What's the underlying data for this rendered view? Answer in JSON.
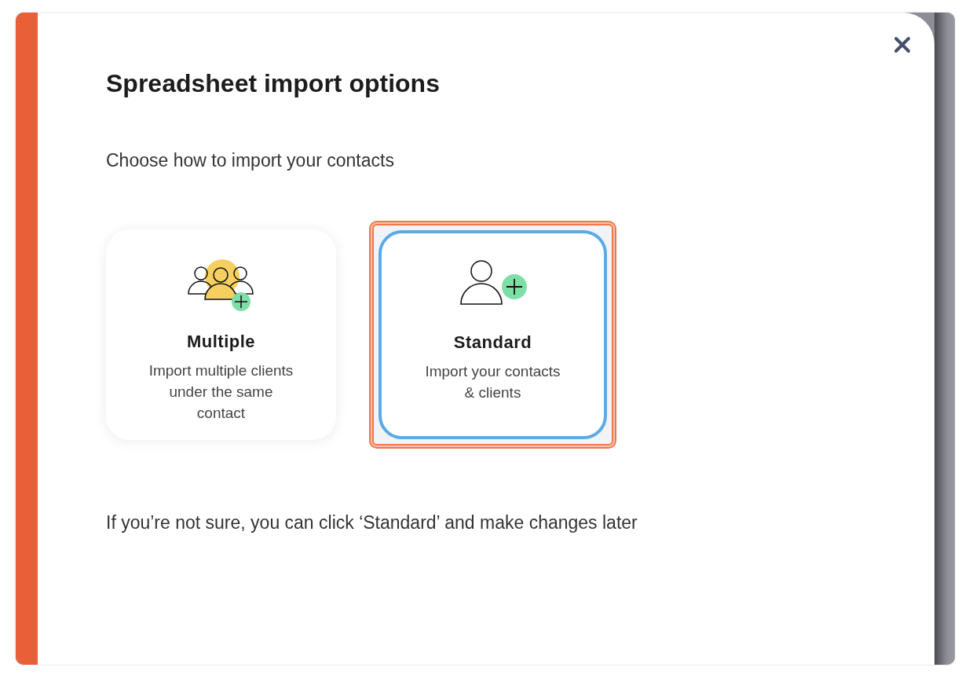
{
  "dialog": {
    "title": "Spreadsheet import options",
    "prompt": "Choose how to import your contacts",
    "note": "If you’re not sure, you can click ‘Standard’ and make changes later"
  },
  "options": [
    {
      "kind": "group",
      "title": "Multiple",
      "description": "Import multiple clients under the same contact",
      "selected": false
    },
    {
      "kind": "single",
      "title": "Standard",
      "description": "Import your contacts & clients",
      "selected": true
    }
  ]
}
